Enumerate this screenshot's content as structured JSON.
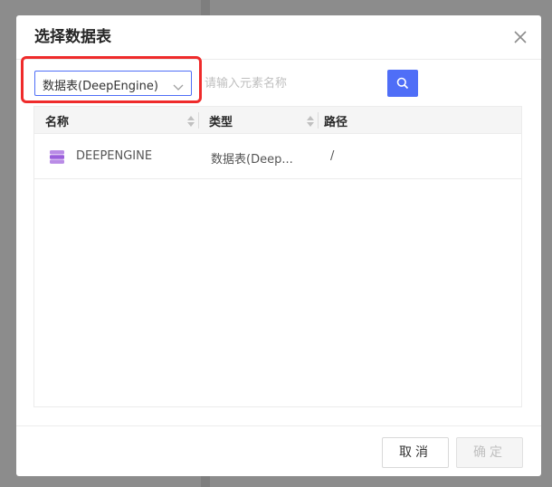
{
  "dialog": {
    "title": "选择数据表",
    "close_icon": "close-icon"
  },
  "toolbar": {
    "type_select_value": "数据表(DeepEngine)",
    "search_placeholder": "请输入元素名称",
    "search_icon": "search-icon"
  },
  "table": {
    "columns": [
      {
        "label": "名称",
        "sortable": true
      },
      {
        "label": "类型",
        "sortable": true
      },
      {
        "label": "路径",
        "sortable": false
      }
    ],
    "rows": [
      {
        "icon": "database-icon",
        "name": "DEEPENGINE",
        "type": "数据表(Deep...",
        "path": "/"
      }
    ]
  },
  "footer": {
    "cancel_label": "取消",
    "ok_label": "确定"
  },
  "colors": {
    "accent": "#4f6ef7",
    "highlight": "#ef2b2b",
    "db_icon": "#a66be0"
  }
}
